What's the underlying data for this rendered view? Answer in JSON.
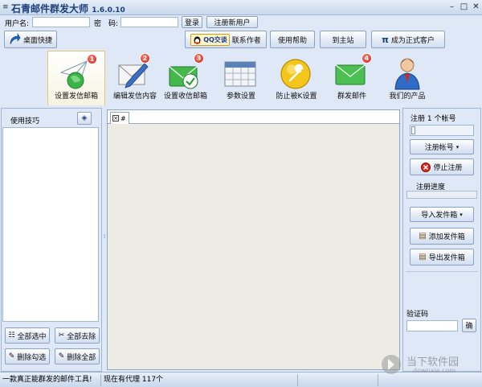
{
  "window": {
    "title": "石青邮件群发大师",
    "version": "1.6.0.10",
    "controls": [
      "minimize-icon",
      "maximize-icon",
      "close-icon"
    ]
  },
  "login": {
    "username_label": "用户名:",
    "username_value": "",
    "password_label": "密　码:",
    "password_value": "",
    "login_button": "登录",
    "register_button": "注册新用户"
  },
  "toolbar": {
    "desktop_shortcut": "桌面快捷",
    "qq_badge": "QQ交谈",
    "contact_author": "联系作者",
    "help": "使用帮助",
    "home_site": "到主站",
    "upgrade": "成为正式客户",
    "upgrade_symbol": "π"
  },
  "modules": [
    {
      "label": "设置发信邮箱",
      "badge": "1",
      "icon": "send-mailbox-icon",
      "selected": true
    },
    {
      "label": "编辑发信内容",
      "badge": "2",
      "icon": "edit-content-icon",
      "selected": false
    },
    {
      "label": "设置收信邮箱",
      "badge": "3",
      "icon": "receive-mailbox-icon",
      "selected": false
    },
    {
      "label": "参数设置",
      "badge": "",
      "icon": "settings-grid-icon",
      "selected": false
    },
    {
      "label": "防止被K设置",
      "badge": "",
      "icon": "wrench-icon",
      "selected": false
    },
    {
      "label": "群发邮件",
      "badge": "4",
      "icon": "mail-envelope-icon",
      "selected": false
    },
    {
      "label": "我们的产品",
      "badge": "",
      "icon": "person-icon",
      "selected": false
    }
  ],
  "left_panel": {
    "title": "使用技巧",
    "buttons": {
      "select_all": "全部选中",
      "remove_all": "全部去除",
      "delete_checked": "删除勾选",
      "delete_all": "删除全部"
    }
  },
  "center": {
    "tab_label": "#"
  },
  "right_panel": {
    "register_count": "注册 1 个帐号",
    "register_accounts": "注册帐号",
    "stop_register": "停止注册",
    "progress_label": "注册进度",
    "progress": 0,
    "import_sender": "导入发件箱",
    "add_sender": "添加发件箱",
    "export_sender": "导出发件箱",
    "captcha_label": "验证码",
    "captcha_value": "",
    "confirm": "确"
  },
  "status": {
    "slogan": "一款真正能群发的邮件工具!",
    "proxy": "现在有代理 117个"
  },
  "watermark": {
    "name": "当下软件园",
    "url": "downxia.com"
  },
  "colors": {
    "frame": "#dfe8f6",
    "border": "#9fb6d4",
    "accent": "#1c3f7a",
    "badge": "#d21f12"
  }
}
